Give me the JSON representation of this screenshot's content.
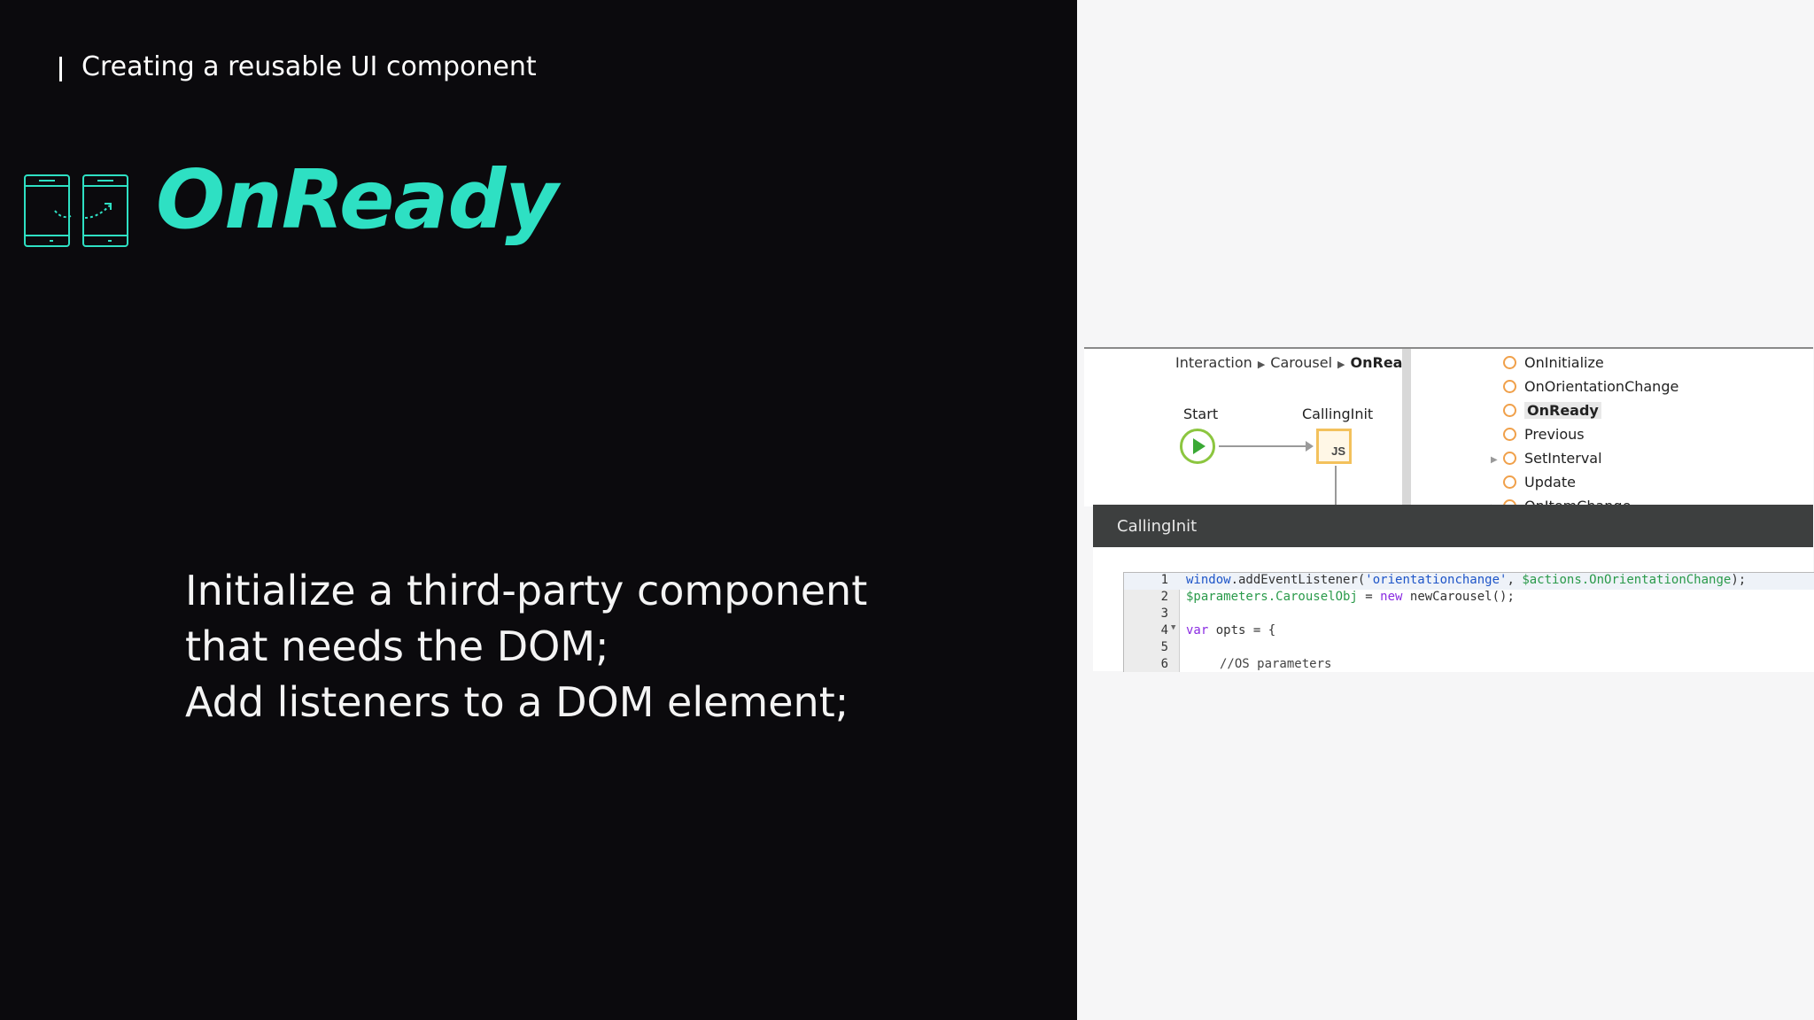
{
  "slide": {
    "kicker": "Creating a reusable UI component",
    "title": "OnReady",
    "bullets": [
      "Initialize a third-party component",
      "that needs the DOM;",
      "Add listeners to a DOM element;"
    ],
    "accent_color": "#2ee0c3",
    "icon": "phone-rotation-icon"
  },
  "screenshot": {
    "breadcrumb": [
      "Interaction",
      "Carousel",
      "OnReady"
    ],
    "flow": {
      "start_label": "Start",
      "node_label": "CallingInit",
      "node_badge": "JS"
    },
    "tree": [
      {
        "label": "OnInitialize"
      },
      {
        "label": "OnOrientationChange"
      },
      {
        "label": "OnReady"
      },
      {
        "label": "Previous"
      },
      {
        "label": "SetInterval"
      },
      {
        "label": "Update"
      },
      {
        "label": "OnItemChange"
      }
    ],
    "dialog_title": "CallingInit",
    "code": {
      "line_numbers": [
        "1",
        "2",
        "3",
        "4",
        "5",
        "6"
      ],
      "line1": {
        "obj": "window",
        "call": ".addEventListener(",
        "str": "'orientationchange'",
        "sep": ", ",
        "var": "$actions.OnOrientationChange",
        "end": ");"
      },
      "line2": {
        "var": "$parameters.CarouselObj",
        "op": " = ",
        "kw": "new",
        "rest": " newCarousel();"
      },
      "line4": {
        "kw": "var",
        "rest": " opts = {"
      },
      "line6": {
        "comment": "//OS parameters"
      }
    }
  }
}
